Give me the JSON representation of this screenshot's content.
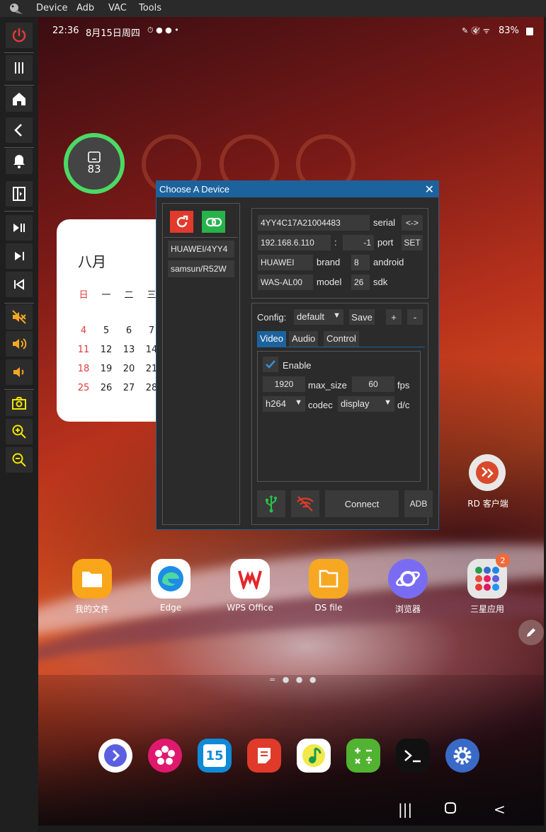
{
  "menubar": {
    "items": [
      "Device",
      "Adb",
      "VAC",
      "Tools"
    ]
  },
  "status": {
    "time": "22:36",
    "date": "8月15日周四",
    "battery": "83%"
  },
  "battery_widget": {
    "value": "83"
  },
  "calendar": {
    "month": "八月",
    "weekdays": [
      "日",
      "一",
      "二",
      "三"
    ],
    "rows": [
      [
        "4",
        "5",
        "6",
        "7"
      ],
      [
        "11",
        "12",
        "13",
        "14"
      ],
      [
        "18",
        "19",
        "20",
        "21"
      ],
      [
        "25",
        "26",
        "27",
        "28"
      ]
    ]
  },
  "rd_app": {
    "label": "RD 客户端"
  },
  "apps": [
    {
      "label": "我的文件",
      "icon": "folder-icon",
      "color": "#f9a61a"
    },
    {
      "label": "Edge",
      "icon": "edge-icon",
      "color": "#ffffff"
    },
    {
      "label": "WPS Office",
      "icon": "wps-icon",
      "color": "#ffffff"
    },
    {
      "label": "DS file",
      "icon": "ds-file-icon",
      "color": "#f7a823"
    },
    {
      "label": "浏览器",
      "icon": "browser-icon",
      "color": "#7a6cf2"
    },
    {
      "label": "三星应用",
      "icon": "samsung-apps-folder-icon",
      "color": "#e6e6e6"
    }
  ],
  "apps_badge": "2",
  "dock": [
    {
      "icon": "chevron-right-app-icon",
      "color": "#5b5fe0"
    },
    {
      "icon": "flower-icon",
      "color": "#e0196e"
    },
    {
      "icon": "calendar-15-icon",
      "color": "#0f8ad8",
      "text": "15"
    },
    {
      "icon": "notes-icon",
      "color": "#e03a2a"
    },
    {
      "icon": "music-icon",
      "color": "#f2e84a"
    },
    {
      "icon": "calculator-icon",
      "color": "#52b232"
    },
    {
      "icon": "terminal-icon",
      "color": "#111111"
    },
    {
      "icon": "settings-icon",
      "color": "#3a6ac8"
    }
  ],
  "dialog": {
    "title": "Choose A Device",
    "devices": [
      "HUAWEI/4YY4",
      "samsun/R52W"
    ],
    "serial_value": "4YY4C17A21004483",
    "serial_label": "serial",
    "swap_button": "<->",
    "ip_value": "192.168.6.110",
    "colon": ":",
    "port_value": "-1",
    "port_label": "port",
    "set_button": "SET",
    "brand_value": "HUAWEI",
    "brand_label": "brand",
    "android_value": "8",
    "android_label": "android",
    "model_value": "WAS-AL00",
    "model_label": "model",
    "sdk_value": "26",
    "sdk_label": "sdk",
    "config_label": "Config:",
    "config_value": "default",
    "save_button": "Save",
    "plus_button": "+",
    "minus_button": "-",
    "tabs": [
      "Video",
      "Audio",
      "Control"
    ],
    "enable_label": "Enable",
    "max_size_value": "1920",
    "max_size_label": "max_size",
    "fps_value": "60",
    "fps_label": "fps",
    "codec_value": "h264",
    "codec_label": "codec",
    "dc_value": "display",
    "dc_label": "d/c",
    "connect_button": "Connect",
    "adb_button": "ADB"
  }
}
